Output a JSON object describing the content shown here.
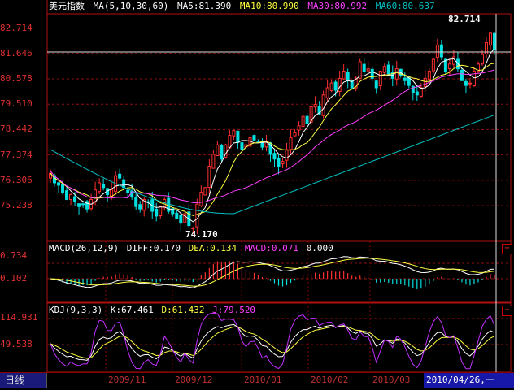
{
  "main_panel": {
    "title": "美元指数",
    "ma_label": "MA(5,10,30,60)",
    "ma5": "MA5:81.390",
    "ma10": "MA10:80.990",
    "ma30": "MA30:80.992",
    "ma60": "MA60:80.637",
    "y_ticks": [
      "82.714",
      "81.646",
      "80.578",
      "79.510",
      "78.442",
      "77.374",
      "76.306",
      "75.238"
    ],
    "high_label": "82.714",
    "low_label": "74.170"
  },
  "macd_panel": {
    "label": "MACD(26,12,9)",
    "diff": "DIFF:0.170",
    "dea": "DEA:0.134",
    "macd": "MACD:0.071",
    "extra": "0.000",
    "y_ticks": [
      "0.734",
      "0.102"
    ]
  },
  "kdj_panel": {
    "label": "KDJ(9,3,3)",
    "k": "K:67.461",
    "d": "D:61.432",
    "j": "J:79.520",
    "y_ticks": [
      "114.931",
      "49.538"
    ]
  },
  "bottom_bar": {
    "period_tab": "日线",
    "dates": [
      "2009/11",
      "2009/12",
      "2010/01",
      "2010/02",
      "2010/03"
    ],
    "cursor_date": "2010/04/26,一"
  },
  "buttons": {
    "macd_expand": "+",
    "kdj_expand": "+"
  },
  "colors": {
    "up": "#ff3030",
    "down": "#00e0e0",
    "ma5": "#ffffff",
    "ma10": "#ffff40",
    "ma30": "#ff40ff",
    "ma60": "#00c0c0",
    "grid": "#a01010",
    "axis_text": "#e03030"
  },
  "chart_data": {
    "type": "candlestick",
    "series_count": 110,
    "price_range": [
      74.17,
      82.714
    ],
    "macd_range": [
      -0.3,
      0.85
    ],
    "kdj_range": [
      0,
      120
    ]
  }
}
